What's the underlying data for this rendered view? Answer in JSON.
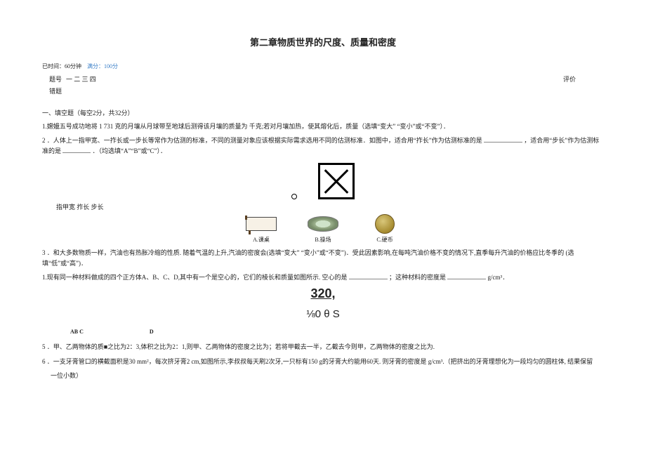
{
  "title": "第二章物质世界的尺度、质量和密度",
  "meta": {
    "time_label": "已时间：",
    "time_value": "60分钟",
    "score_label": "满分：",
    "score_value": "100分"
  },
  "header_row": {
    "tihao_label": "题号",
    "items": "一 二 三 四",
    "pingjia": "评价",
    "cuoti": "错题"
  },
  "section1": "一、填空题（每空2分，共32分）",
  "q1": "1.嫦娥五号成功地将 1 731 克的月壤从月球带至地球后测得该月壤的质量为   千克;若对月壤加热，使其熔化后，质量（选填“变大” “变小”或“不变”）．",
  "q2a": "2 ．人体上一指甲宽、一拃长或一步长等常作为估测的标准，不同的测量对象应该根据实际需求选用不同的估测标准．如图中，适合用“拃长”作为估测标准的是",
  "q2b": "，适合用“步长”作为估测标准的是",
  "q2c": "．（均选填“A”“B”或“C”）．",
  "q2_small": "指甲宽 拃长 步长",
  "captions": {
    "a": "A.课桌",
    "b": "B.操场",
    "c": "C.硬币"
  },
  "q3a": "3 ．和大多数物质一样，汽油也有热胀冷缩的性质. 随着气温的上升,汽油的密度会(选填“变大” “变小”或“不变”)．受此因素影响,在每吨汽油价格不变的情况下,直季每升汽油的价格应比冬季的   (选填“低”或“高”)．",
  "q4a": "1.现有同一种材料做成的四个正方体A、B、C、D,其中有一个是空心的，它们的棱长和质量如图所示. 空心的是",
  "q4b": "；这种材料的密度是",
  "q4c": "g/cm³．",
  "center1": "320,",
  "center2": "⅛0 θ S",
  "abcd": {
    "left": "AB C",
    "right": "D"
  },
  "q5": "5 ．甲、乙两物体的质■之比为2：3,体积之比为2：1,则甲、乙两物体的密度之比为；若将甲截去一半，乙截去今则甲，乙两物体的密度之比为.",
  "q6a": "6 ．一支牙膏管口的横截面积是30 mm²，每次挤牙膏2 cm,如图所示,李叔叔每天刷2次牙,一只标有150 g的牙膏大约能用60天. 则牙膏的密度是   g/cm³.（把挤出的牙膏理想化为一段均匀的圆柱体, 结果保留",
  "q6b": "一位小数）"
}
